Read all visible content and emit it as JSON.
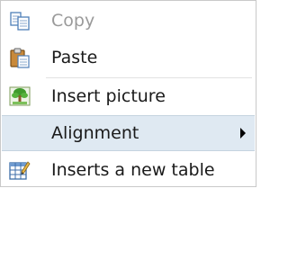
{
  "context_menu": {
    "items": [
      {
        "label": "Copy",
        "icon": "copy-icon",
        "enabled": false
      },
      {
        "label": "Paste",
        "icon": "paste-icon",
        "enabled": true
      },
      {
        "label": "Insert picture",
        "icon": "insert-picture-icon",
        "enabled": true
      },
      {
        "label": "Alignment",
        "icon": "",
        "enabled": true,
        "submenu": true,
        "highlighted": true
      },
      {
        "label": "Inserts a new table",
        "icon": "insert-table-icon",
        "enabled": true
      }
    ]
  },
  "colors": {
    "highlight": "#dfe9f2",
    "disabled_text": "#9a9a9a",
    "text": "#1a1a1a"
  }
}
